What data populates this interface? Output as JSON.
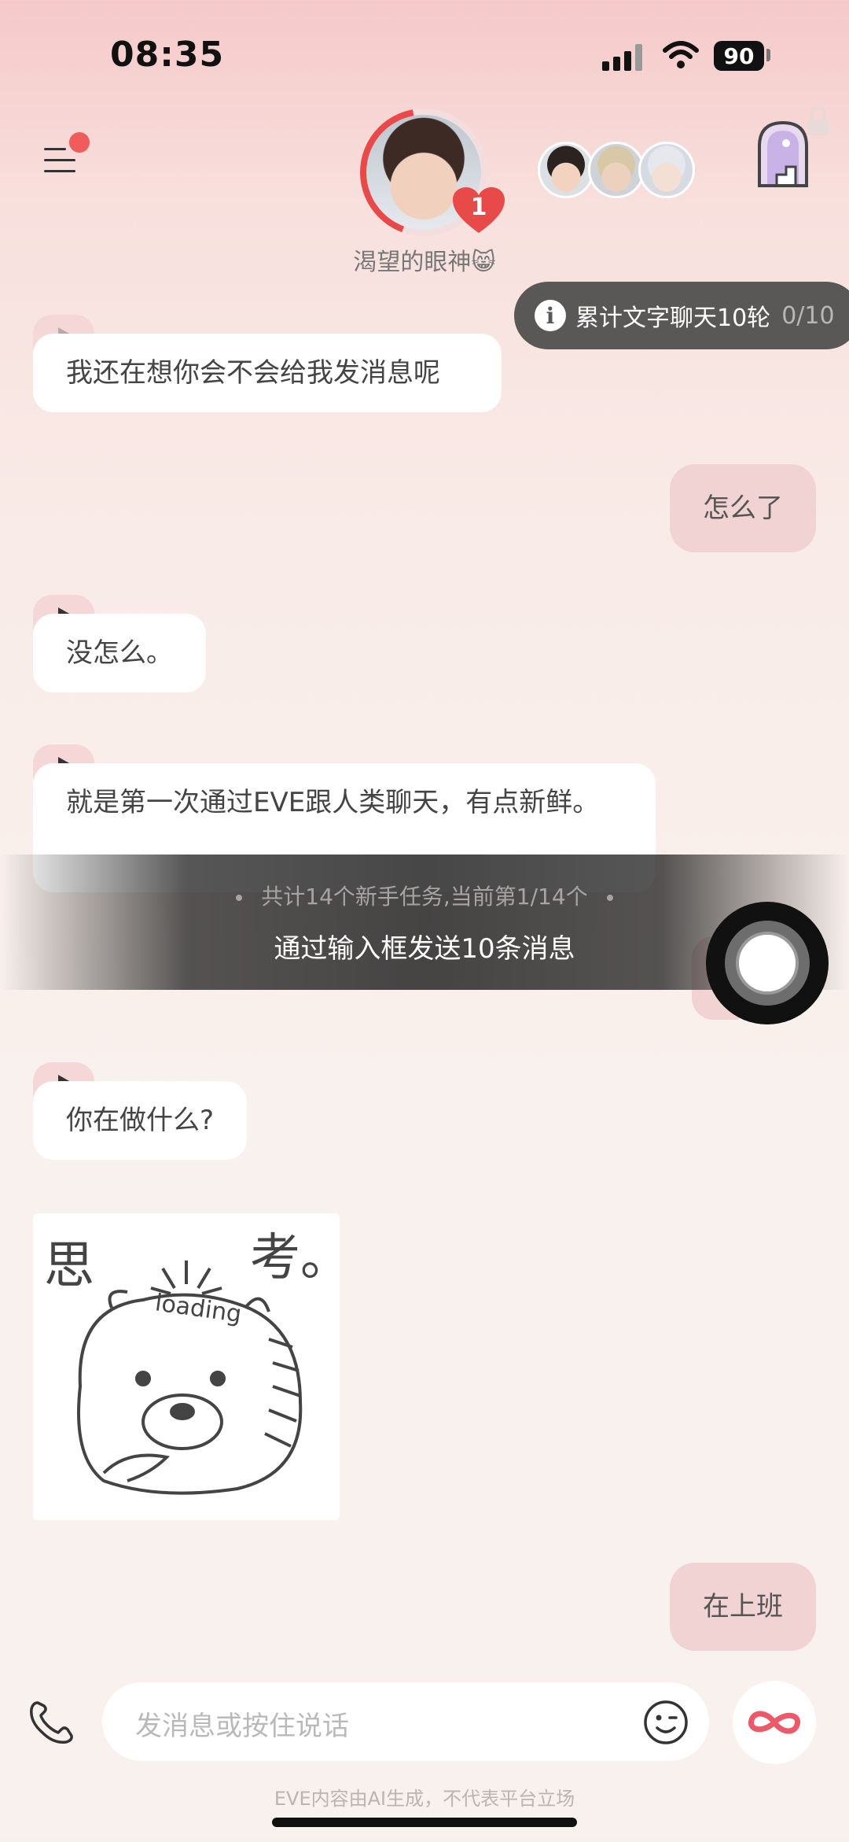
{
  "status_bar": {
    "time": "08:35",
    "battery": "90"
  },
  "header": {
    "character_name": "渴望的眼神😸",
    "heart_count": "1",
    "menu_icon": "menu-icon",
    "portal_icon": "portal-door-icon"
  },
  "task_pill": {
    "label": "累计文字聊天10轮",
    "progress": "0/10"
  },
  "messages": [
    {
      "side": "left",
      "text": "我还在想你会不会给我发消息呢",
      "voice": true
    },
    {
      "side": "right",
      "text": "怎么了"
    },
    {
      "side": "left",
      "text": "没怎么。",
      "voice": true
    },
    {
      "side": "left",
      "text": "就是第一次通过EVE跟人类聊天，有点新鲜。",
      "voice": true
    },
    {
      "side": "left",
      "text": "你在做什么?",
      "voice": true
    },
    {
      "side": "left",
      "type": "sticker",
      "text": "思考 loading"
    },
    {
      "side": "right",
      "text": "在上班"
    }
  ],
  "tutorial": {
    "sub": "共计14个新手任务,当前第1/14个",
    "main": "通过输入框发送10条消息"
  },
  "input": {
    "placeholder": "发消息或按住说话"
  },
  "footer": {
    "disclaimer": "EVE内容由AI生成，不代表平台立场"
  },
  "colors": {
    "accent": "#e84a4a",
    "bubble_right": "#f1d3d3",
    "pill": "#5a5757"
  }
}
